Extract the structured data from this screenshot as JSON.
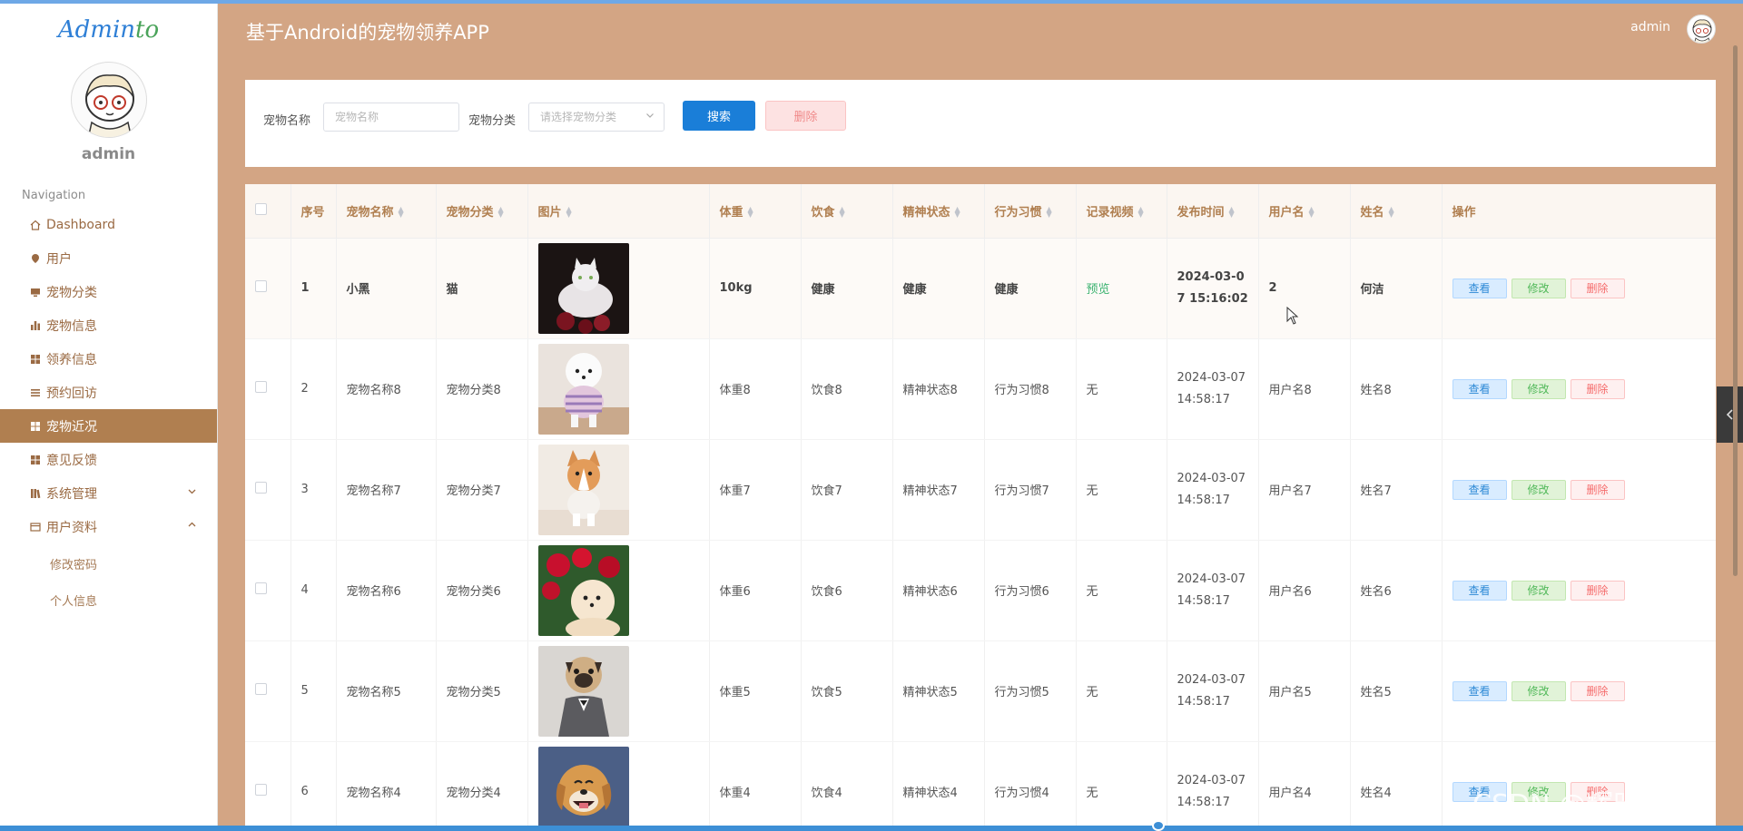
{
  "app": {
    "logo_part1": "Admin",
    "logo_part2": "to",
    "page_title": "基于Android的宠物领养APP",
    "username": "admin"
  },
  "sidebar": {
    "username": "admin",
    "nav_title": "Navigation",
    "items": [
      {
        "label": "Dashboard",
        "icon": "home-icon"
      },
      {
        "label": "用户",
        "icon": "pin-icon"
      },
      {
        "label": "宠物分类",
        "icon": "monitor-icon"
      },
      {
        "label": "宠物信息",
        "icon": "bar-chart-icon"
      },
      {
        "label": "领养信息",
        "icon": "grid-icon"
      },
      {
        "label": "预约回访",
        "icon": "list-icon"
      },
      {
        "label": "宠物近况",
        "icon": "grid-icon",
        "active": true
      },
      {
        "label": "意见反馈",
        "icon": "grid-icon"
      },
      {
        "label": "系统管理",
        "icon": "library-icon"
      },
      {
        "label": "用户资料",
        "icon": "card-icon"
      }
    ],
    "sub_items": [
      "修改密码",
      "个人信息"
    ],
    "active_color": "#b07f50"
  },
  "search": {
    "name_label": "宠物名称",
    "name_placeholder": "宠物名称",
    "category_label": "宠物分类",
    "category_placeholder": "请选择宠物分类",
    "search_button": "搜索",
    "delete_button": "删除"
  },
  "table": {
    "headers": [
      "序号",
      "宠物名称",
      "宠物分类",
      "图片",
      "体重",
      "饮食",
      "精神状态",
      "行为习惯",
      "记录视频",
      "发布时间",
      "用户名",
      "姓名",
      "操作"
    ],
    "rows": [
      {
        "no": "1",
        "name": "小黑",
        "category": "猫",
        "weight": "10kg",
        "diet": "健康",
        "mental": "健康",
        "behavior": "健康",
        "video": "预览",
        "date": "2024-03-0",
        "time": "7 15:16:02",
        "username": "2",
        "realname": "何洁"
      },
      {
        "no": "2",
        "name": "宠物名称8",
        "category": "宠物分类8",
        "weight": "体重8",
        "diet": "饮食8",
        "mental": "精神状态8",
        "behavior": "行为习惯8",
        "video": "无",
        "date": "2024-03-07",
        "time": "14:58:17",
        "username": "用户名8",
        "realname": "姓名8"
      },
      {
        "no": "3",
        "name": "宠物名称7",
        "category": "宠物分类7",
        "weight": "体重7",
        "diet": "饮食7",
        "mental": "精神状态7",
        "behavior": "行为习惯7",
        "video": "无",
        "date": "2024-03-07",
        "time": "14:58:17",
        "username": "用户名7",
        "realname": "姓名7"
      },
      {
        "no": "4",
        "name": "宠物名称6",
        "category": "宠物分类6",
        "weight": "体重6",
        "diet": "饮食6",
        "mental": "精神状态6",
        "behavior": "行为习惯6",
        "video": "无",
        "date": "2024-03-07",
        "time": "14:58:17",
        "username": "用户名6",
        "realname": "姓名6"
      },
      {
        "no": "5",
        "name": "宠物名称5",
        "category": "宠物分类5",
        "weight": "体重5",
        "diet": "饮食5",
        "mental": "精神状态5",
        "behavior": "行为习惯5",
        "video": "无",
        "date": "2024-03-07",
        "time": "14:58:17",
        "username": "用户名5",
        "realname": "姓名5"
      },
      {
        "no": "6",
        "name": "宠物名称4",
        "category": "宠物分类4",
        "weight": "体重4",
        "diet": "饮食4",
        "mental": "精神状态4",
        "behavior": "行为习惯4",
        "video": "无",
        "date": "2024-03-07",
        "time": "14:58:17",
        "username": "用户名4",
        "realname": "姓名4"
      }
    ],
    "actions": {
      "view": "查看",
      "edit": "修改",
      "delete": "删除"
    }
  },
  "watermark": "CSDN @辉时科技",
  "colors": {
    "background": "#d3a584",
    "primary": "#1a7ed8",
    "danger": "#f56c6c",
    "success": "#52b95a"
  }
}
